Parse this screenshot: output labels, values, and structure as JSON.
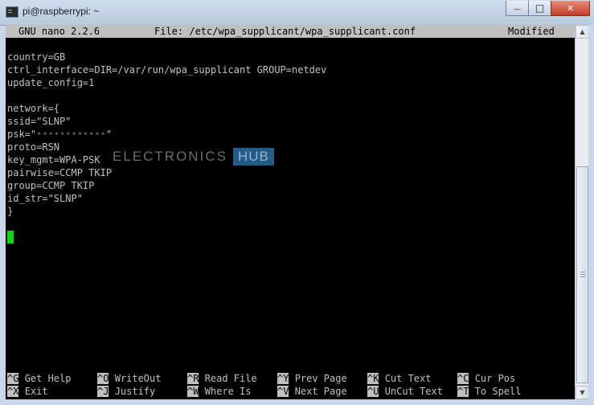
{
  "window": {
    "title": "pi@raspberrypi: ~",
    "buttons": {
      "minimize": "—",
      "maximize": "□",
      "close": "✕"
    }
  },
  "nano": {
    "version": "GNU nano 2.2.6",
    "file": "File: /etc/wpa_supplicant/wpa_supplicant.conf",
    "status": "Modified"
  },
  "content": {
    "lines": [
      "",
      "country=GB",
      "ctrl_interface=DIR=/var/run/wpa_supplicant GROUP=netdev",
      "update_config=1",
      "",
      "network={",
      "ssid=\"SLNP\"",
      "psk=\"",
      "proto=RSN",
      "key_mgmt=WPA-PSK",
      "pairwise=CCMP TKIP",
      "group=CCMP TKIP",
      "id_str=\"SLNP\"",
      "}"
    ],
    "psk_masked": "••••••••••••",
    "psk_close": "\""
  },
  "watermark": {
    "left": "ELECTRONICS",
    "right": "HUB"
  },
  "shortcuts": [
    [
      {
        "key": "^G",
        "label": "Get Help"
      },
      {
        "key": "^X",
        "label": "Exit"
      }
    ],
    [
      {
        "key": "^O",
        "label": "WriteOut"
      },
      {
        "key": "^J",
        "label": "Justify"
      }
    ],
    [
      {
        "key": "^R",
        "label": "Read File"
      },
      {
        "key": "^W",
        "label": "Where Is"
      }
    ],
    [
      {
        "key": "^Y",
        "label": "Prev Page"
      },
      {
        "key": "^V",
        "label": "Next Page"
      }
    ],
    [
      {
        "key": "^K",
        "label": "Cut Text"
      },
      {
        "key": "^U",
        "label": "UnCut Text"
      }
    ],
    [
      {
        "key": "^C",
        "label": "Cur Pos"
      },
      {
        "key": "^T",
        "label": "To Spell"
      }
    ]
  ]
}
